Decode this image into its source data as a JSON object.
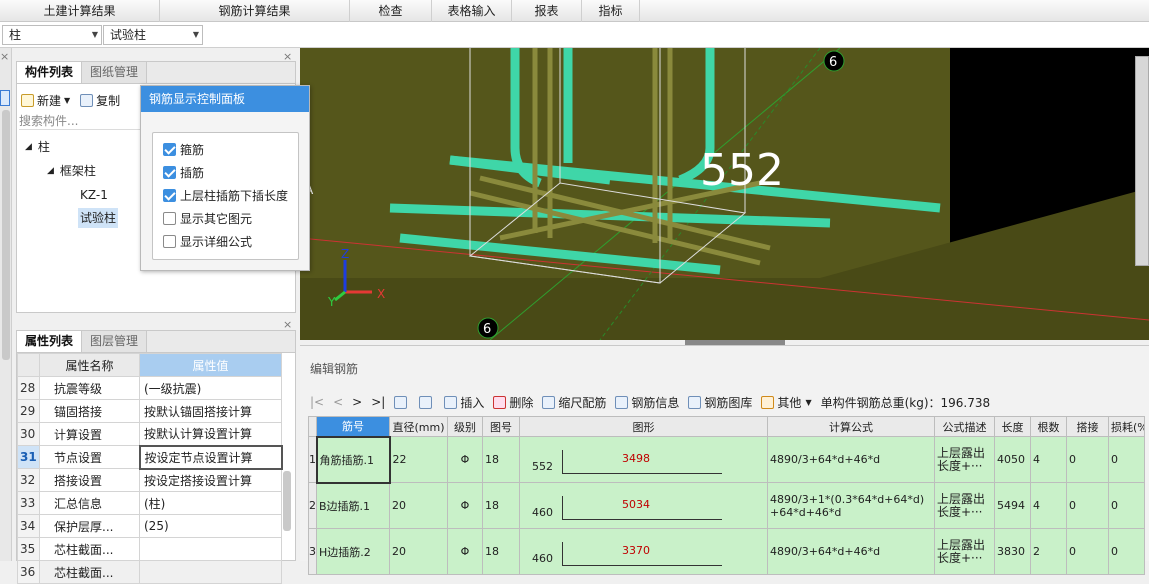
{
  "top_tabs": [
    "土建计算结果",
    "钢筋计算结果",
    "检查",
    "表格输入",
    "报表",
    "指标"
  ],
  "selectors": {
    "category": "柱",
    "component": "试验柱"
  },
  "component_panel": {
    "tabs": [
      "构件列表",
      "图纸管理"
    ],
    "toolbar": {
      "new": "新建",
      "copy": "复制"
    },
    "search_placeholder": "搜索构件...",
    "tree": {
      "root": "柱",
      "group": "框架柱",
      "items": [
        "KZ-1",
        "试验柱"
      ]
    }
  },
  "popup": {
    "title": "钢筋显示控制面板",
    "options": [
      {
        "label": "箍筋",
        "checked": true
      },
      {
        "label": "插筋",
        "checked": true
      },
      {
        "label": "上层柱插筋下插长度",
        "checked": true
      },
      {
        "label": "显示其它图元",
        "checked": false
      },
      {
        "label": "显示详细公式",
        "checked": false
      }
    ]
  },
  "view3d": {
    "dimension": "552",
    "axis_label_top": "6",
    "axis_label_bottom": "6",
    "axis_label_left": "A",
    "axes": {
      "x": "X",
      "y": "Y",
      "z": "Z"
    }
  },
  "property_panel": {
    "tabs": [
      "属性列表",
      "图层管理"
    ],
    "headers": [
      "属性名称",
      "属性值"
    ],
    "rows": [
      {
        "num": "28",
        "name": "抗震等级",
        "value": "(一级抗震)"
      },
      {
        "num": "29",
        "name": "锚固搭接",
        "value": "按默认锚固搭接计算"
      },
      {
        "num": "30",
        "name": "计算设置",
        "value": "按默认计算设置计算"
      },
      {
        "num": "31",
        "name": "节点设置",
        "value": "按设定节点设置计算"
      },
      {
        "num": "32",
        "name": "搭接设置",
        "value": "按设定搭接设置计算"
      },
      {
        "num": "33",
        "name": "汇总信息",
        "value": "(柱)"
      },
      {
        "num": "34",
        "name": "保护层厚...",
        "value": "(25)"
      },
      {
        "num": "35",
        "name": "芯柱截面...",
        "value": ""
      },
      {
        "num": "36",
        "name": "芯柱截面...",
        "value": ""
      }
    ]
  },
  "editor": {
    "title": "编辑钢筋",
    "nav": [
      "|<",
      "<",
      ">",
      ">|"
    ],
    "toolbar": [
      "插入",
      "删除",
      "缩尺配筋",
      "钢筋信息",
      "钢筋图库",
      "其他"
    ],
    "total_label": "单构件钢筋总重(kg)：196.738",
    "headers": [
      "筋号",
      "直径(mm)",
      "级别",
      "图号",
      "图形",
      "计算公式",
      "公式描述",
      "长度",
      "根数",
      "搭接",
      "损耗(%)"
    ],
    "rows": [
      {
        "idx": "1",
        "name": "角筋插筋.1",
        "diameter": "22",
        "grade": "Φ",
        "fig": "18",
        "shape_left": "552",
        "shape_len": "3498",
        "formula": "4890/3+64*d+46*d",
        "desc": "上层露出长度+···",
        "length": "4050",
        "count": "4",
        "lap": "0",
        "loss": "0"
      },
      {
        "idx": "2",
        "name": "B边插筋.1",
        "diameter": "20",
        "grade": "Φ",
        "fig": "18",
        "shape_left": "460",
        "shape_len": "5034",
        "formula": "4890/3+1*(0.3*64*d+64*d)",
        "formula2": "+64*d+46*d",
        "desc": "上层露出长度+···",
        "length": "5494",
        "count": "4",
        "lap": "0",
        "loss": "0"
      },
      {
        "idx": "3",
        "name": "H边插筋.2",
        "diameter": "20",
        "grade": "Φ",
        "fig": "18",
        "shape_left": "460",
        "shape_len": "3370",
        "formula": "4890/3+64*d+46*d",
        "desc": "上层露出长度+···",
        "length": "3830",
        "count": "2",
        "lap": "0",
        "loss": "0"
      }
    ]
  },
  "colors": {
    "accent": "#3c8fe0",
    "row_green": "#c9f1c9",
    "rebar_teal": "#3fd6a8",
    "concrete": "#5a5a1c",
    "shape_red": "#c00000"
  }
}
